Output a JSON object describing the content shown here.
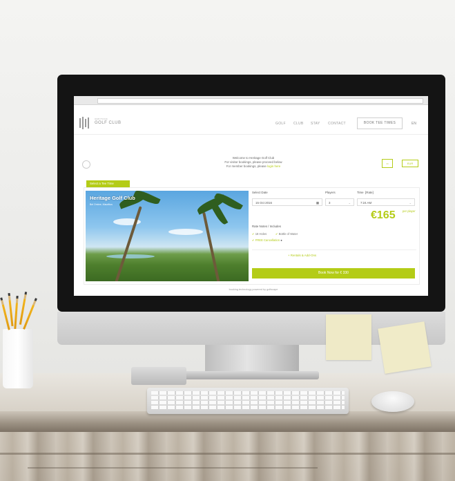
{
  "site": {
    "logo_top": "HERITAGE",
    "logo_name": "GOLF CLUB"
  },
  "nav": {
    "links": [
      "GOLF",
      "CLUB",
      "STAY",
      "CONTACT"
    ],
    "book_button": "BOOK TEE TIMES",
    "language": "EN"
  },
  "welcome": {
    "line1": "Welcome to Heritage Golf Club",
    "line2": "For visitor bookings, please proceed below",
    "line3_prefix": "For member bookings, please",
    "line3_link": "login here"
  },
  "toolbar": {
    "currency": "EUR"
  },
  "booking": {
    "tag": "Select a Tee Time",
    "course_title": "Heritage Golf Club",
    "course_location": "Bel Ombre, Mauritius",
    "select_date_label": "Select Date",
    "date_value": "15 Oct 2016",
    "players_label": "Players",
    "players_value": "3",
    "time_label": "Time",
    "time_rate_label": "[Rate]",
    "time_value": "7:24 AM",
    "price": "€165",
    "per_player": "per player",
    "rate_notes_label": "Rate Notes / Includes",
    "includes": [
      "18 Holes",
      "Bottle of Water"
    ],
    "free_cancel": "FREE Cancellation",
    "addons": "+ Rentals & Add-Ons",
    "book_now": "Book Now for  € 330",
    "powered_by": "booking technology powered by  golfscape"
  }
}
